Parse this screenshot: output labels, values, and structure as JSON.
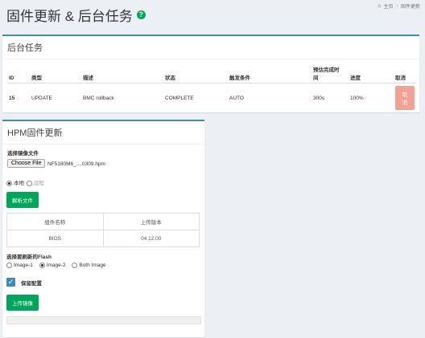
{
  "page": {
    "title": "固件更新 & 后台任务",
    "help_icon": "question-circle-icon"
  },
  "breadcrumb": {
    "home": "主页",
    "current": "固件更新"
  },
  "tasks": {
    "title": "后台任务",
    "columns": {
      "id": "ID",
      "type": "类型",
      "desc": "描述",
      "status": "状态",
      "trigger": "触发条件",
      "eta": "预估完成时间",
      "progress": "进度",
      "cancel": "取消"
    },
    "rows": [
      {
        "id": "15",
        "type": "UPDATE",
        "desc": "BMC rollback",
        "status": "COMPLETE",
        "trigger": "AUTO",
        "eta": "300s",
        "progress": "100%",
        "cancel": "取消"
      }
    ]
  },
  "hpm": {
    "title": "HPM固件更新",
    "select_file_label": "选择镜像文件",
    "choose_file": "Choose File",
    "file_name": "NF5180M6_....0309.hpm",
    "source_local": "本地",
    "source_remote": "远程",
    "source_selected": "local",
    "parse_button": "解析文件",
    "comp_col_name": "组件名称",
    "comp_col_version": "上传版本",
    "components": [
      {
        "name": "BIOS",
        "version": "04.12.00"
      }
    ],
    "flash_label": "选择要刷新的Flash",
    "flash_options": [
      "Image-1",
      "Image-2",
      "Both Image"
    ],
    "flash_selected": "Image-2",
    "keep_config": "保留配置",
    "keep_config_checked": true,
    "upload_button": "上传镜像",
    "upload_progress": 0
  },
  "colors": {
    "accent": "#3c8dbc",
    "success": "#00a65a",
    "cancel": "#f2a196"
  }
}
